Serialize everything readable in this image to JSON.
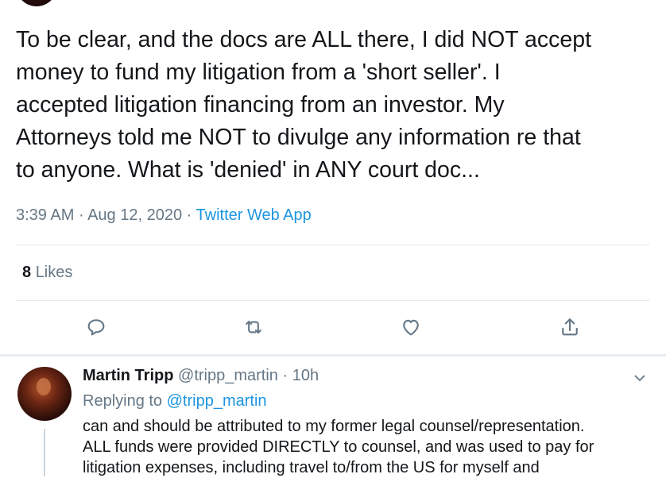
{
  "tweet": {
    "lines": [
      "To be clear, and the docs are ALL there, I did NOT accept",
      "money to fund my litigation from a 'short seller'.  I",
      "accepted litigation financing from an investor.  My",
      "Attorneys told me NOT to divulge any information re that",
      "to anyone.  What is 'denied' in ANY court doc..."
    ],
    "time": "3:39 AM",
    "date": "Aug 12, 2020",
    "separator": "·",
    "source": "Twitter Web App",
    "likes_count": "8",
    "likes_label": "Likes"
  },
  "actions": {
    "reply_icon": "reply-icon",
    "retweet_icon": "retweet-icon",
    "like_icon": "heart-icon",
    "share_icon": "share-icon"
  },
  "reply": {
    "name": "Martin Tripp",
    "handle": "@tripp_martin",
    "separator": "·",
    "age": "10h",
    "replying_label": "Replying to",
    "replying_handle": "@tripp_martin",
    "lines": [
      "can and should be attributed to my former legal counsel/representation.",
      "ALL funds were provided DIRECTLY to counsel, and was used to pay for",
      "litigation expenses, including travel to/from the US for myself and"
    ]
  },
  "colors": {
    "text": "#14171a",
    "secondary": "#657786",
    "link": "#1b95e0",
    "divider": "#e6ecf0"
  }
}
